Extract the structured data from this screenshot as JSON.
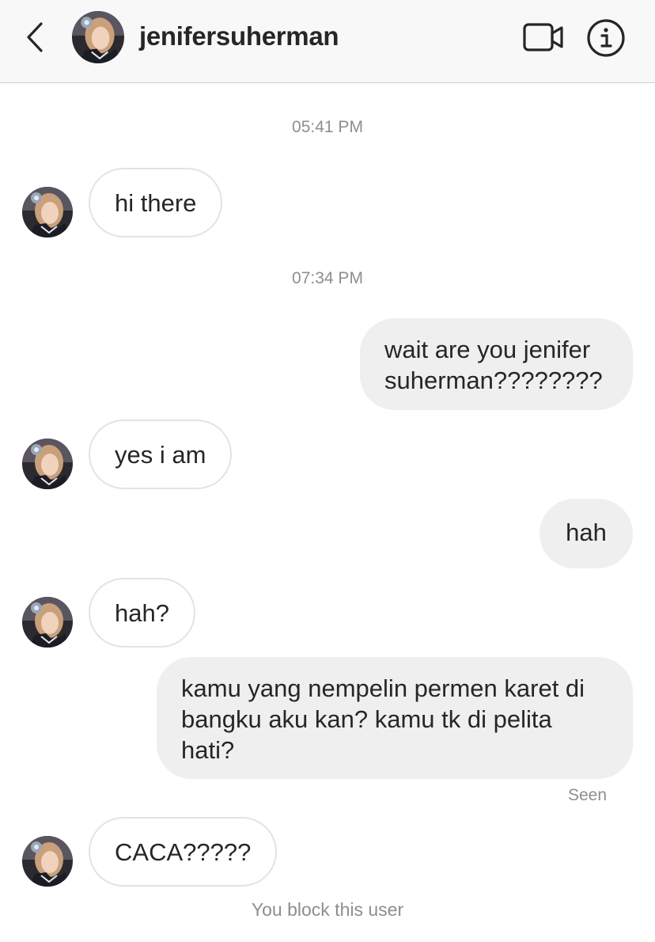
{
  "header": {
    "username": "jenifersuherman",
    "back_icon": "chevron-left-icon",
    "video_icon": "video-camera-icon",
    "info_icon": "info-circle-icon"
  },
  "timestamps": [
    "05:41 PM",
    "07:34 PM"
  ],
  "messages": [
    {
      "from": "them",
      "text": "hi there"
    },
    {
      "from": "me",
      "text": "wait are you jenifer suherman????????"
    },
    {
      "from": "them",
      "text": "yes i am"
    },
    {
      "from": "me",
      "text": "hah"
    },
    {
      "from": "them",
      "text": "hah?"
    },
    {
      "from": "me",
      "text": "kamu yang nempelin permen karet di bangku aku kan? kamu tk di pelita hati?"
    },
    {
      "from": "them",
      "text": "CACA?????"
    }
  ],
  "seen_label": "Seen",
  "blocked_notice": "You block this user",
  "colors": {
    "header_bg": "#f8f8f8",
    "outgoing_bubble": "#efefef",
    "incoming_border": "#e3e3e3",
    "meta_text": "#8e8e8e"
  }
}
